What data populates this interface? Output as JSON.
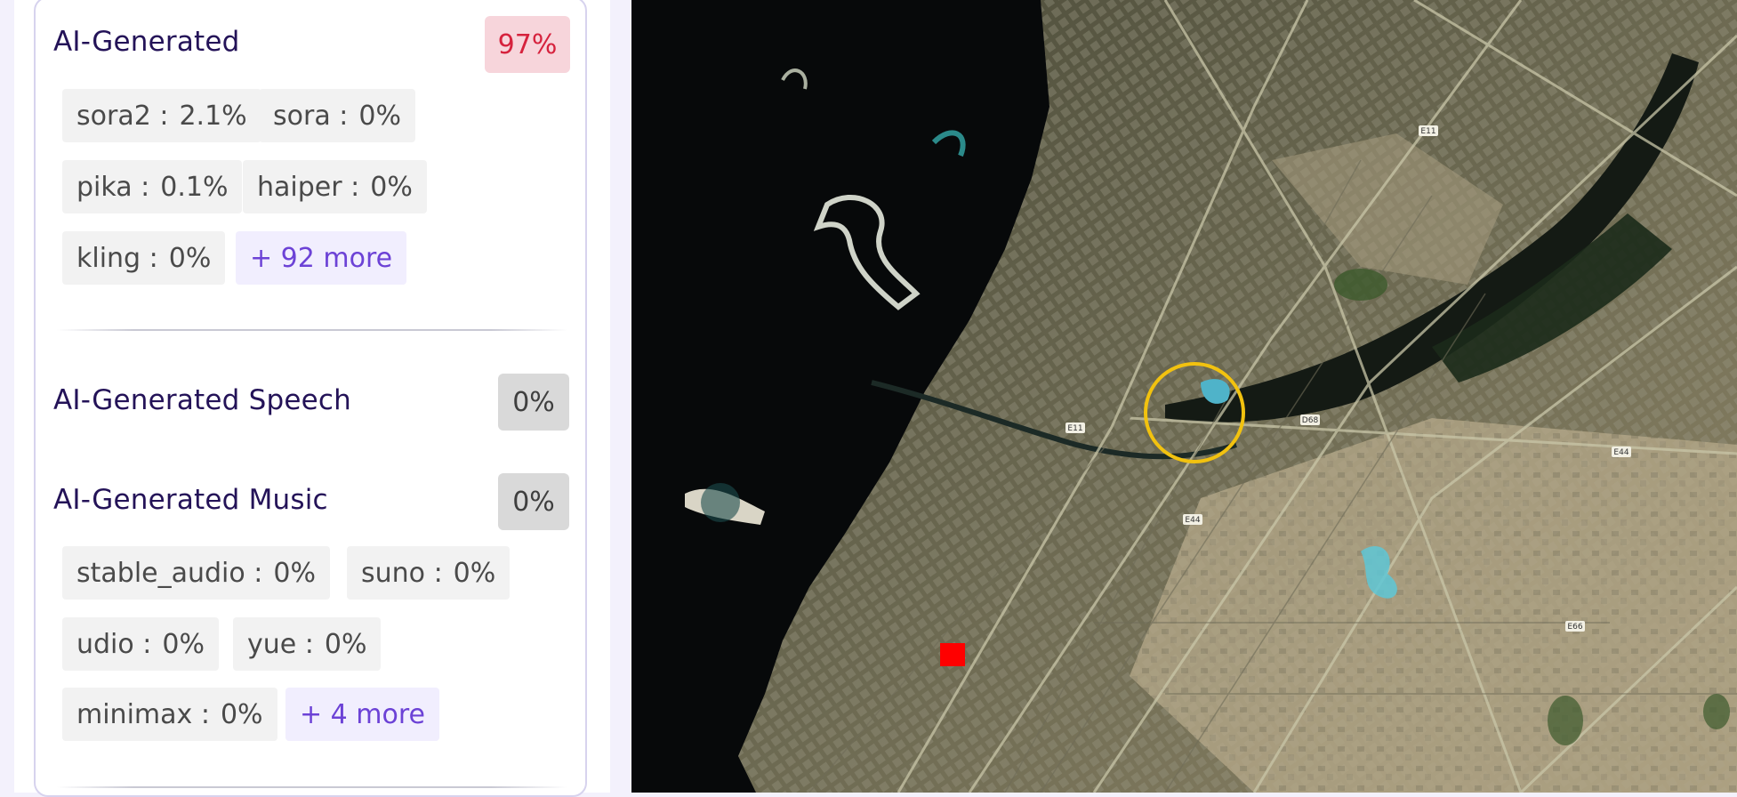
{
  "ai_generated": {
    "title": "AI-Generated",
    "score": "97%",
    "score_color": "#d6223d",
    "chips": [
      {
        "name": "sora2",
        "value": "2.1%"
      },
      {
        "name": "sora",
        "value": "0%"
      },
      {
        "name": "pika",
        "value": "0.1%"
      },
      {
        "name": "haiper",
        "value": "0%"
      },
      {
        "name": "kling",
        "value": "0%"
      }
    ],
    "more": "+ 92 more"
  },
  "speech": {
    "title": "AI-Generated Speech",
    "score": "0%"
  },
  "music": {
    "title": "AI-Generated Music",
    "score": "0%",
    "chips": [
      {
        "name": "stable_audio",
        "value": "0%"
      },
      {
        "name": "suno",
        "value": "0%"
      },
      {
        "name": "udio",
        "value": "0%"
      },
      {
        "name": "yue",
        "value": "0%"
      },
      {
        "name": "minimax",
        "value": "0%"
      }
    ],
    "more": "+ 4 more"
  },
  "chip_separator": ":",
  "map": {
    "road_labels": [
      "E11",
      "E11",
      "D68",
      "E44",
      "E44",
      "E66"
    ],
    "marker_circle_color": "#f2c20f",
    "marker_square_color": "#ff0000"
  }
}
